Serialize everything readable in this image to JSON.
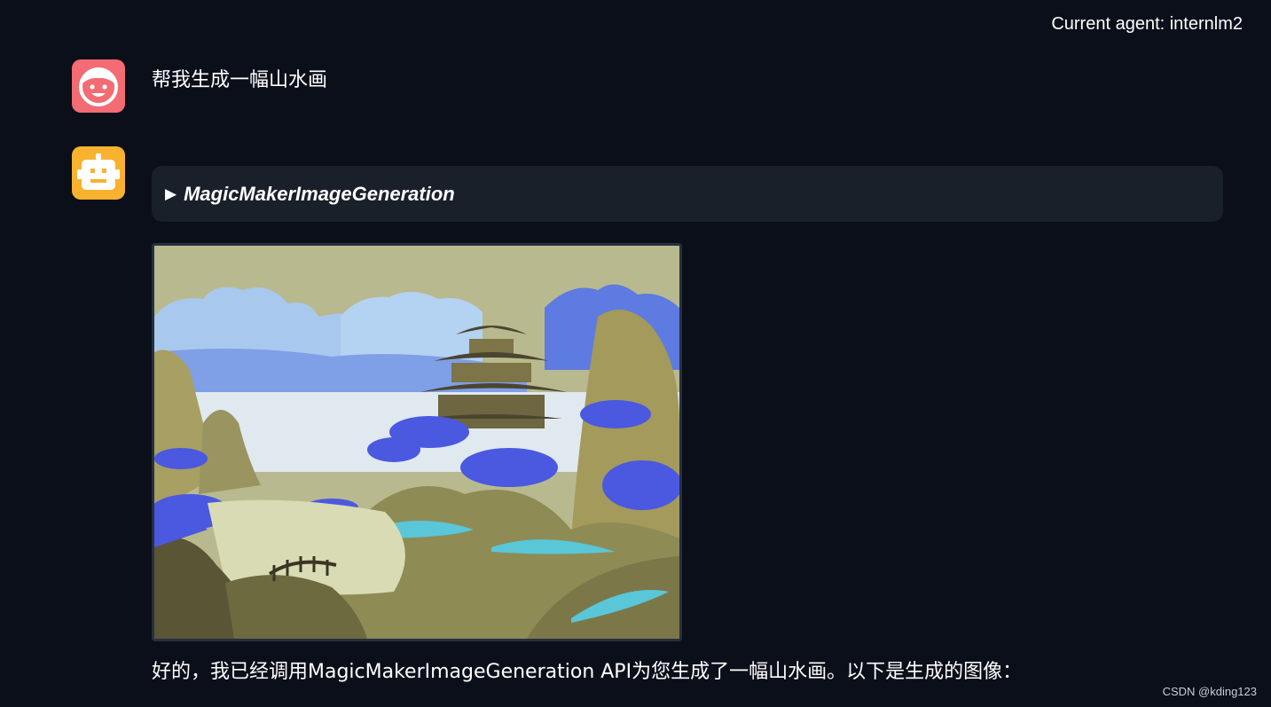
{
  "header": {
    "agent_label": "Current agent: internlm2"
  },
  "conversation": {
    "user_message": "帮我生成一幅山水画",
    "tool_call": {
      "name": "MagicMakerImageGeneration",
      "expand_icon": "triangle-right"
    },
    "generated_image": {
      "subject": "landscape-painting"
    },
    "assistant_reply": "好的，我已经调用MagicMakerImageGeneration API为您生成了一幅山水画。以下是生成的图像："
  },
  "avatars": {
    "user": "user-face-icon",
    "assistant": "robot-icon"
  },
  "colors": {
    "background": "#0b0f19",
    "panel": "#1a202a",
    "user_avatar": "#f36b73",
    "bot_avatar": "#f8b230"
  },
  "watermark": "CSDN @kding123"
}
